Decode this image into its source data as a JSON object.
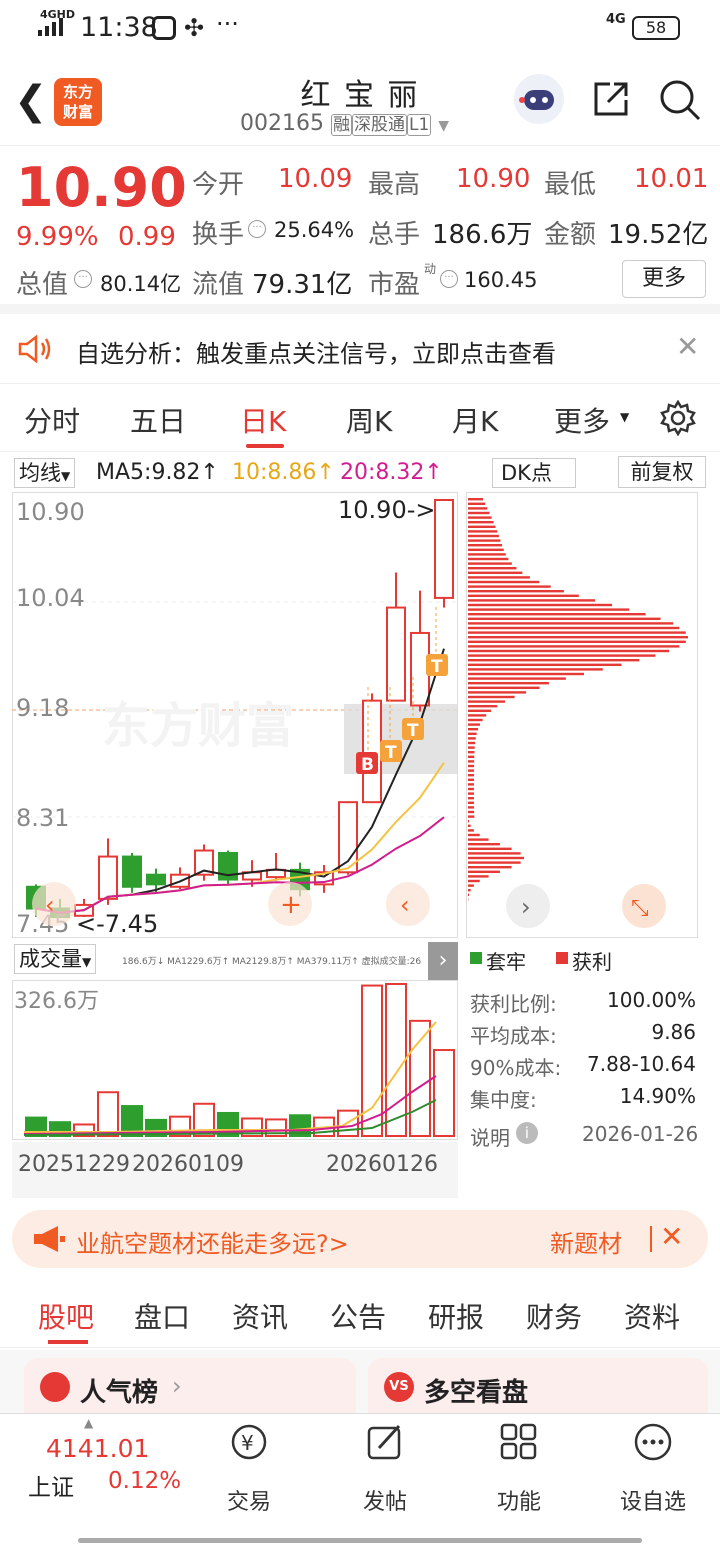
{
  "status": {
    "time": "11:38",
    "network": "4GHD",
    "network2": "4G",
    "battery": "58"
  },
  "header": {
    "brand": "东方\n财富",
    "stock_name": "红 宝 丽",
    "stock_code": "002165",
    "tag_rong": "融",
    "tag_sgt": "深股通",
    "tag_l1": "L1"
  },
  "quote": {
    "price": "10.90",
    "change_pct": "9.99%",
    "change": "0.99",
    "open_label": "今开",
    "open": "10.09",
    "high_label": "最高",
    "high": "10.90",
    "low_label": "最低",
    "low": "10.01",
    "turnover_label": "换手",
    "turnover": "25.64%",
    "volume_label": "总手",
    "volume": "186.6万",
    "amount_label": "金额",
    "amount": "19.52亿",
    "mcap_label": "总值",
    "mcap": "80.14亿",
    "float_label": "流值",
    "float": "79.31亿",
    "pe_label": "市盈",
    "pe_sup": "动",
    "pe": "160.45",
    "more_label": "更多"
  },
  "alert": {
    "text": "自选分析：触发重点关注信号，立即点击查看"
  },
  "tabs": [
    "分时",
    "五日",
    "日K",
    "周K",
    "月K",
    "更多"
  ],
  "active_tab": "日K",
  "kline": {
    "ma_selector": "均线",
    "ma5": "MA5:9.82↑",
    "ma10": "10:8.86↑",
    "ma20": "20:8.32↑",
    "dk_label": "DK点",
    "fq_label": "前复权",
    "y_labels": [
      "10.90",
      "10.04",
      "9.18",
      "8.31",
      "7.45"
    ],
    "high_marker": "10.90->",
    "low_marker": "<-7.45",
    "watermark": "东方财富"
  },
  "chip": {
    "legend_trapped": "套牢",
    "legend_profit": "获利",
    "rows": [
      {
        "label": "获利比例:",
        "value": "100.00%"
      },
      {
        "label": "平均成本:",
        "value": "9.86"
      },
      {
        "label": "90%成本:",
        "value": "7.88-10.64"
      },
      {
        "label": "集中度:",
        "value": "14.90%"
      }
    ],
    "note_label": "说明",
    "date": "2026-01-26"
  },
  "volume": {
    "selector": "成交量",
    "info": "186.6万↓ MA1229.6万↑ MA2129.8万↑ MA379.11万↑ 虚拟成交量:263.1万",
    "max_label": "326.6万",
    "dates": [
      "20251229",
      "20260109",
      "20260126"
    ]
  },
  "banner": {
    "text": "业航空题材还能走多远?>",
    "tag": "新题材"
  },
  "bottom_tabs": [
    "股吧",
    "盘口",
    "资讯",
    "公告",
    "研报",
    "财务",
    "资料"
  ],
  "cards": [
    {
      "title": "人气榜"
    },
    {
      "title": "多空看盘"
    }
  ],
  "bottom_bar": {
    "index_value": "4141.01",
    "index_name": "上证",
    "index_pct": "0.12%",
    "items": [
      "交易",
      "发帖",
      "功能",
      "设自选"
    ]
  },
  "chart_data": {
    "type": "candlestick",
    "y_range": [
      7.45,
      10.9
    ],
    "candles": [
      {
        "o": 7.7,
        "c": 7.52,
        "h": 7.72,
        "l": 7.45
      },
      {
        "o": 7.52,
        "c": 7.45,
        "h": 7.6,
        "l": 7.45
      },
      {
        "o": 7.46,
        "c": 7.55,
        "h": 7.6,
        "l": 7.45
      },
      {
        "o": 7.6,
        "c": 7.95,
        "h": 8.1,
        "l": 7.55
      },
      {
        "o": 7.95,
        "c": 7.7,
        "h": 7.98,
        "l": 7.65
      },
      {
        "o": 7.8,
        "c": 7.72,
        "h": 7.85,
        "l": 7.65
      },
      {
        "o": 7.7,
        "c": 7.8,
        "h": 7.86,
        "l": 7.68
      },
      {
        "o": 7.8,
        "c": 8.0,
        "h": 8.05,
        "l": 7.75
      },
      {
        "o": 7.98,
        "c": 7.76,
        "h": 8.0,
        "l": 7.72
      },
      {
        "o": 7.76,
        "c": 7.82,
        "h": 7.92,
        "l": 7.7
      },
      {
        "o": 7.78,
        "c": 7.84,
        "h": 7.98,
        "l": 7.75
      },
      {
        "o": 7.84,
        "c": 7.68,
        "h": 7.9,
        "l": 7.62
      },
      {
        "o": 7.72,
        "c": 7.82,
        "h": 7.88,
        "l": 7.65
      },
      {
        "o": 7.82,
        "c": 8.4,
        "h": 8.4,
        "l": 7.8
      },
      {
        "o": 8.4,
        "c": 9.24,
        "h": 9.3,
        "l": 8.4
      },
      {
        "o": 9.24,
        "c": 10.01,
        "h": 10.3,
        "l": 9.24
      },
      {
        "o": 9.2,
        "c": 9.8,
        "h": 10.15,
        "l": 9.15
      },
      {
        "o": 10.09,
        "c": 10.9,
        "h": 10.9,
        "l": 10.01
      }
    ],
    "volume": [
      40,
      30,
      25,
      95,
      65,
      35,
      42,
      70,
      50,
      38,
      36,
      45,
      40,
      55,
      326.6,
      330,
      250,
      186.6
    ]
  }
}
